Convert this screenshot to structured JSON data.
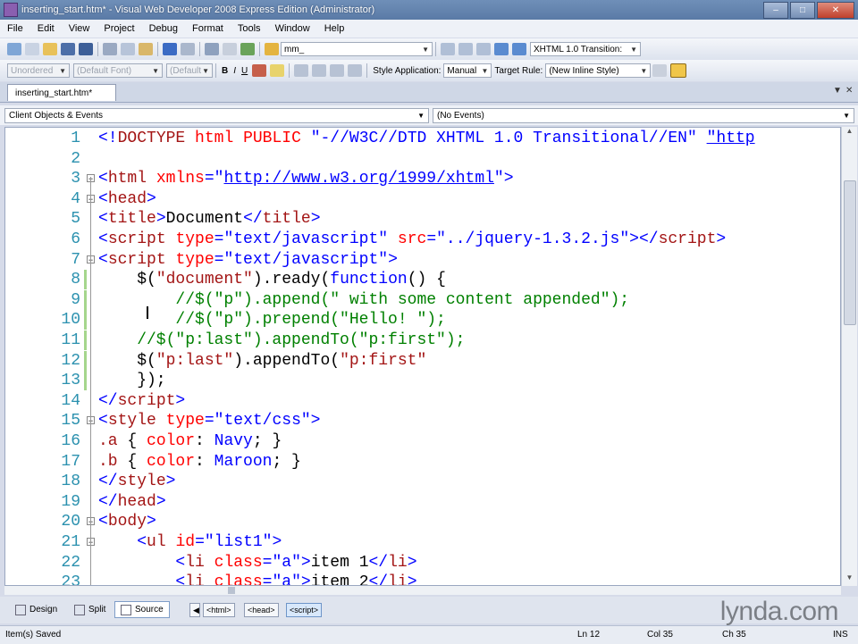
{
  "window": {
    "title": "inserting_start.htm* - Visual Web Developer 2008 Express Edition (Administrator)"
  },
  "menu": [
    "File",
    "Edit",
    "View",
    "Project",
    "Debug",
    "Format",
    "Tools",
    "Window",
    "Help"
  ],
  "toolbar1": {
    "find_value": "mm_",
    "doctype": "XHTML 1.0 Transition:"
  },
  "toolbar2": {
    "block_format": "Unordered",
    "font": "(Default Font)",
    "size": "(Default",
    "bold": "B",
    "italic": "I",
    "underline": "U",
    "style_app_label": "Style Application:",
    "style_app_value": "Manual",
    "target_rule_label": "Target Rule:",
    "target_rule_value": "(New Inline Style)"
  },
  "document_tab": {
    "label": "inserting_start.htm*"
  },
  "nav": {
    "objects": "Client Objects & Events",
    "events": "(No Events)"
  },
  "code_lines": [
    {
      "n": "1",
      "fold": "",
      "segs": [
        [
          "cb",
          "<!"
        ],
        [
          "cm",
          "DOCTYPE"
        ],
        [
          "ct",
          " "
        ],
        [
          "cr",
          "html"
        ],
        [
          "ct",
          " "
        ],
        [
          "cr",
          "PUBLIC"
        ],
        [
          "ct",
          " "
        ],
        [
          "cb",
          "\"-//W3C//DTD XHTML 1.0 Transitional//EN\""
        ],
        [
          "ct",
          " "
        ],
        [
          "cu",
          "\"http"
        ]
      ]
    },
    {
      "n": "2",
      "fold": "",
      "segs": []
    },
    {
      "n": "3",
      "fold": "-",
      "segs": [
        [
          "cb",
          "<"
        ],
        [
          "cm",
          "html"
        ],
        [
          "ct",
          " "
        ],
        [
          "cr",
          "xmlns"
        ],
        [
          "cb",
          "=\""
        ],
        [
          "cu",
          "http://www.w3.org/1999/xhtml"
        ],
        [
          "cb",
          "\">"
        ]
      ]
    },
    {
      "n": "4",
      "fold": "-",
      "segs": [
        [
          "cb",
          "<"
        ],
        [
          "cm",
          "head"
        ],
        [
          "cb",
          ">"
        ]
      ]
    },
    {
      "n": "5",
      "fold": "",
      "segs": [
        [
          "cb",
          "<"
        ],
        [
          "cm",
          "title"
        ],
        [
          "cb",
          ">"
        ],
        [
          "ct",
          "Document"
        ],
        [
          "cb",
          "</"
        ],
        [
          "cm",
          "title"
        ],
        [
          "cb",
          ">"
        ]
      ]
    },
    {
      "n": "6",
      "fold": "",
      "segs": [
        [
          "cb",
          "<"
        ],
        [
          "cm",
          "script"
        ],
        [
          "ct",
          " "
        ],
        [
          "cr",
          "type"
        ],
        [
          "cb",
          "=\"text/javascript\""
        ],
        [
          "ct",
          " "
        ],
        [
          "cr",
          "src"
        ],
        [
          "cb",
          "=\"../jquery-1.3.2.js\"></"
        ],
        [
          "cm",
          "script"
        ],
        [
          "cb",
          ">"
        ]
      ]
    },
    {
      "n": "7",
      "fold": "-",
      "segs": [
        [
          "cb",
          "<"
        ],
        [
          "cm",
          "script"
        ],
        [
          "ct",
          " "
        ],
        [
          "cr",
          "type"
        ],
        [
          "cb",
          "=\"text/javascript\">"
        ]
      ]
    },
    {
      "n": "8",
      "fold": "",
      "segs": [
        [
          "ct",
          "    $("
        ],
        [
          "cs",
          "\"document\""
        ],
        [
          "ct",
          ").ready("
        ],
        [
          "cb",
          "function"
        ],
        [
          "ct",
          "() {"
        ]
      ]
    },
    {
      "n": "9",
      "fold": "",
      "segs": [
        [
          "cg",
          "        //$(\"p\").append(\" with some content appended\");"
        ]
      ]
    },
    {
      "n": "10",
      "fold": "",
      "segs": [
        [
          "cg",
          "        //$(\"p\").prepend(\"Hello! \");"
        ]
      ]
    },
    {
      "n": "11",
      "fold": "",
      "segs": [
        [
          "cg",
          "    //$(\"p:last\").appendTo(\"p:first\");"
        ]
      ]
    },
    {
      "n": "12",
      "fold": "",
      "segs": [
        [
          "ct",
          "    $("
        ],
        [
          "cs",
          "\"p:last\""
        ],
        [
          "ct",
          ").appendTo("
        ],
        [
          "cs",
          "\"p:first\""
        ]
      ]
    },
    {
      "n": "13",
      "fold": "",
      "segs": [
        [
          "ct",
          "    });"
        ]
      ]
    },
    {
      "n": "14",
      "fold": "",
      "segs": [
        [
          "cb",
          "</"
        ],
        [
          "cm",
          "script"
        ],
        [
          "cb",
          ">"
        ]
      ]
    },
    {
      "n": "15",
      "fold": "-",
      "segs": [
        [
          "cb",
          "<"
        ],
        [
          "cm",
          "style"
        ],
        [
          "ct",
          " "
        ],
        [
          "cr",
          "type"
        ],
        [
          "cb",
          "=\"text/css\">"
        ]
      ]
    },
    {
      "n": "16",
      "fold": "",
      "segs": [
        [
          "cm",
          ".a"
        ],
        [
          "ct",
          " { "
        ],
        [
          "cr",
          "color"
        ],
        [
          "ct",
          ": "
        ],
        [
          "cb",
          "Navy"
        ],
        [
          "ct",
          "; }"
        ]
      ]
    },
    {
      "n": "17",
      "fold": "",
      "segs": [
        [
          "cm",
          ".b"
        ],
        [
          "ct",
          " { "
        ],
        [
          "cr",
          "color"
        ],
        [
          "ct",
          ": "
        ],
        [
          "cb",
          "Maroon"
        ],
        [
          "ct",
          "; }"
        ]
      ]
    },
    {
      "n": "18",
      "fold": "",
      "segs": [
        [
          "cb",
          "</"
        ],
        [
          "cm",
          "style"
        ],
        [
          "cb",
          ">"
        ]
      ]
    },
    {
      "n": "19",
      "fold": "",
      "segs": [
        [
          "cb",
          "</"
        ],
        [
          "cm",
          "head"
        ],
        [
          "cb",
          ">"
        ]
      ]
    },
    {
      "n": "20",
      "fold": "-",
      "segs": [
        [
          "cb",
          "<"
        ],
        [
          "cm",
          "body"
        ],
        [
          "cb",
          ">"
        ]
      ]
    },
    {
      "n": "21",
      "fold": "-",
      "segs": [
        [
          "ct",
          "    "
        ],
        [
          "cb",
          "<"
        ],
        [
          "cm",
          "ul"
        ],
        [
          "ct",
          " "
        ],
        [
          "cr",
          "id"
        ],
        [
          "cb",
          "=\"list1\">"
        ]
      ]
    },
    {
      "n": "22",
      "fold": "",
      "segs": [
        [
          "ct",
          "        "
        ],
        [
          "cb",
          "<"
        ],
        [
          "cm",
          "li"
        ],
        [
          "ct",
          " "
        ],
        [
          "cr",
          "class"
        ],
        [
          "cb",
          "=\"a\">"
        ],
        [
          "ct",
          "item 1"
        ],
        [
          "cb",
          "</"
        ],
        [
          "cm",
          "li"
        ],
        [
          "cb",
          ">"
        ]
      ]
    },
    {
      "n": "23",
      "fold": "",
      "segs": [
        [
          "ct",
          "        "
        ],
        [
          "cb",
          "<"
        ],
        [
          "cm",
          "li"
        ],
        [
          "ct",
          " "
        ],
        [
          "cr",
          "class"
        ],
        [
          "cb",
          "=\"a\">"
        ],
        [
          "ct",
          "item 2"
        ],
        [
          "cb",
          "</"
        ],
        [
          "cm",
          "li"
        ],
        [
          "cb",
          ">"
        ]
      ]
    }
  ],
  "view_tabs": [
    "Design",
    "Split",
    "Source"
  ],
  "breadcrumbs": [
    "<html>",
    "<head>",
    "<script>"
  ],
  "logo": "lynda.com",
  "status": {
    "message": "Item(s) Saved",
    "ln": "Ln 12",
    "col": "Col 35",
    "ch": "Ch 35",
    "mode": "INS"
  },
  "colors": {
    "keyword": "#0000ff",
    "tag": "#a31515",
    "attr": "#ff0000",
    "comment": "#008000",
    "line_number": "#2b91af"
  }
}
